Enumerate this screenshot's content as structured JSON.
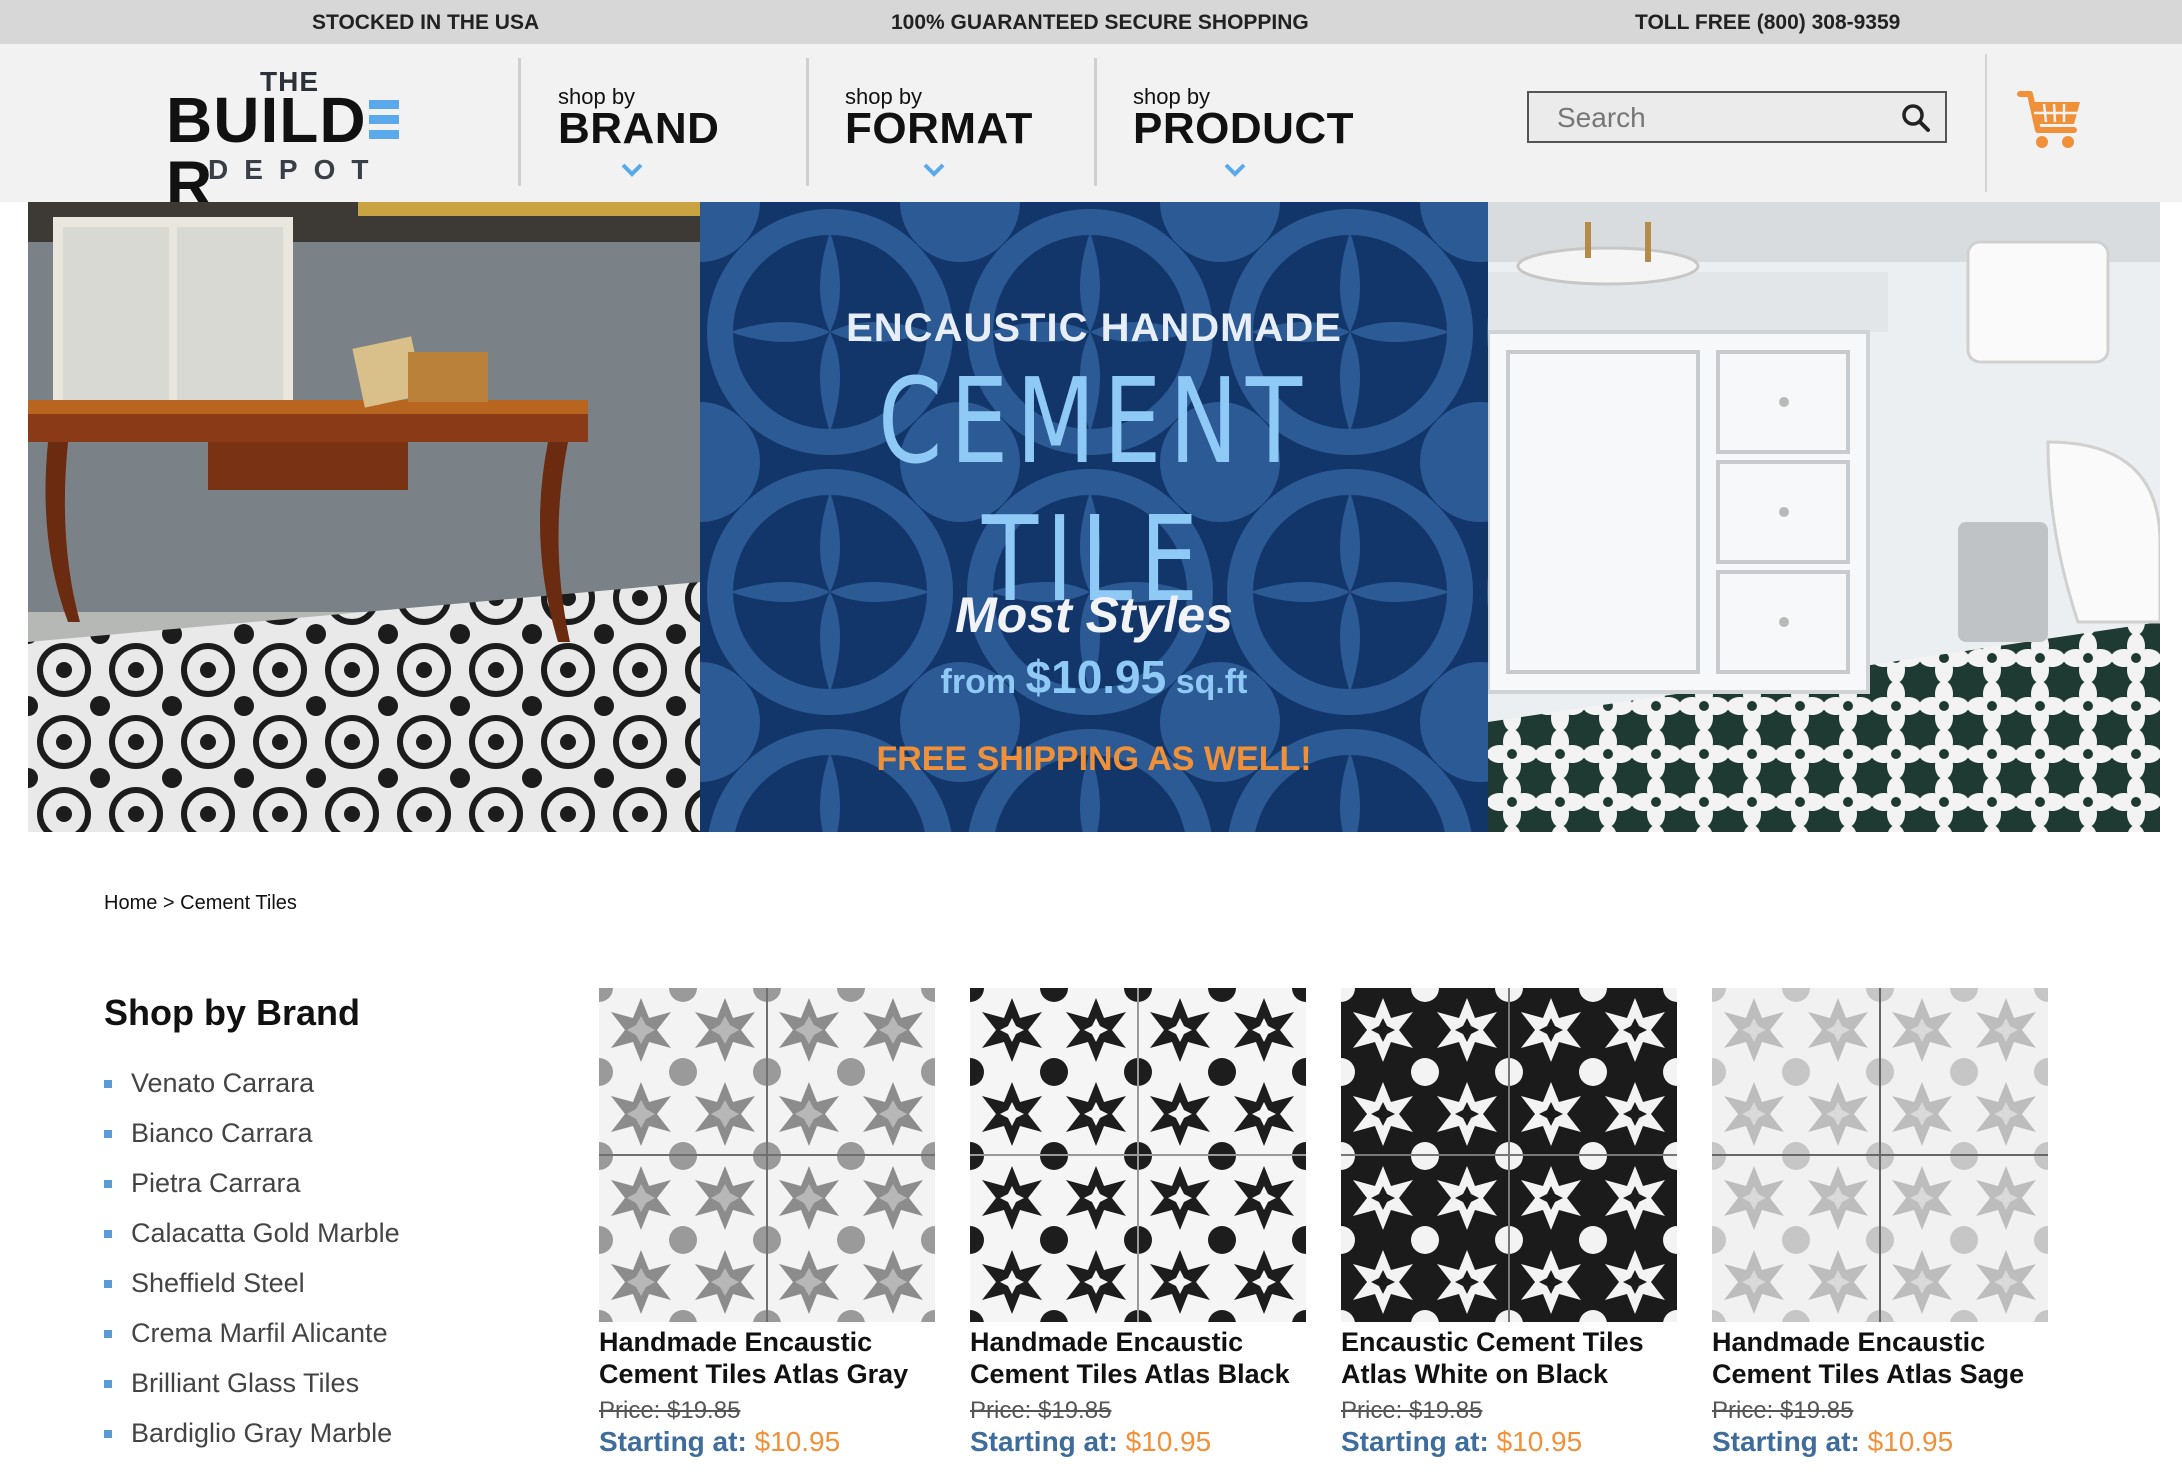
{
  "topbar": {
    "left": "STOCKED IN THE USA",
    "center": "100% GUARANTEED SECURE SHOPPING",
    "right": "TOLL FREE (800) 308-9359"
  },
  "logo": {
    "line1": "THE",
    "line2a": "BUILD",
    "line2b": "R",
    "line3": "DEPOT"
  },
  "nav": [
    {
      "small": "shop by",
      "big": "BRAND"
    },
    {
      "small": "shop by",
      "big": "FORMAT"
    },
    {
      "small": "shop by",
      "big": "PRODUCT"
    }
  ],
  "search": {
    "placeholder": "Search",
    "icon": "magnifier-icon"
  },
  "cart": {
    "icon": "shopping-cart-icon",
    "color": "#f0913a"
  },
  "hero": {
    "line1": "ENCAUSTIC HANDMADE",
    "line2": "CEMENT TILE",
    "line3": "Most Styles",
    "line4_pre": "from",
    "line4_price": "$10.95",
    "line4_post": "sq.ft",
    "line5": "FREE SHIPPING AS WELL!"
  },
  "breadcrumb": {
    "home": "Home",
    "separator": ">",
    "current": "Cement Tiles"
  },
  "sidebar": {
    "title": "Shop by Brand",
    "brands": [
      "Venato Carrara",
      "Bianco Carrara",
      "Pietra Carrara",
      "Calacatta Gold Marble",
      "Sheffield Steel",
      "Crema Marfil Alicante",
      "Brilliant Glass Tiles",
      "Bardiglio Gray Marble"
    ]
  },
  "products": [
    {
      "name": "Handmade Encaustic Cement Tiles Atlas Gray",
      "price": "Price: $19.85",
      "starting_label": "Starting at:",
      "starting_price": "$10.95"
    },
    {
      "name": "Handmade Encaustic Cement Tiles Atlas Black",
      "price": "Price: $19.85",
      "starting_label": "Starting at:",
      "starting_price": "$10.95"
    },
    {
      "name": "Encaustic Cement Tiles Atlas White on Black",
      "price": "Price: $19.85",
      "starting_label": "Starting at:",
      "starting_price": "$10.95"
    },
    {
      "name": "Handmade Encaustic Cement Tiles Atlas Sage",
      "price": "Price: $19.85",
      "starting_label": "Starting at:",
      "starting_price": "$10.95"
    }
  ],
  "colors": {
    "accent_blue": "#5aa9ea",
    "accent_orange": "#f0913a",
    "price_blue": "#3f6d9b",
    "hero_navy": "#12366a"
  }
}
